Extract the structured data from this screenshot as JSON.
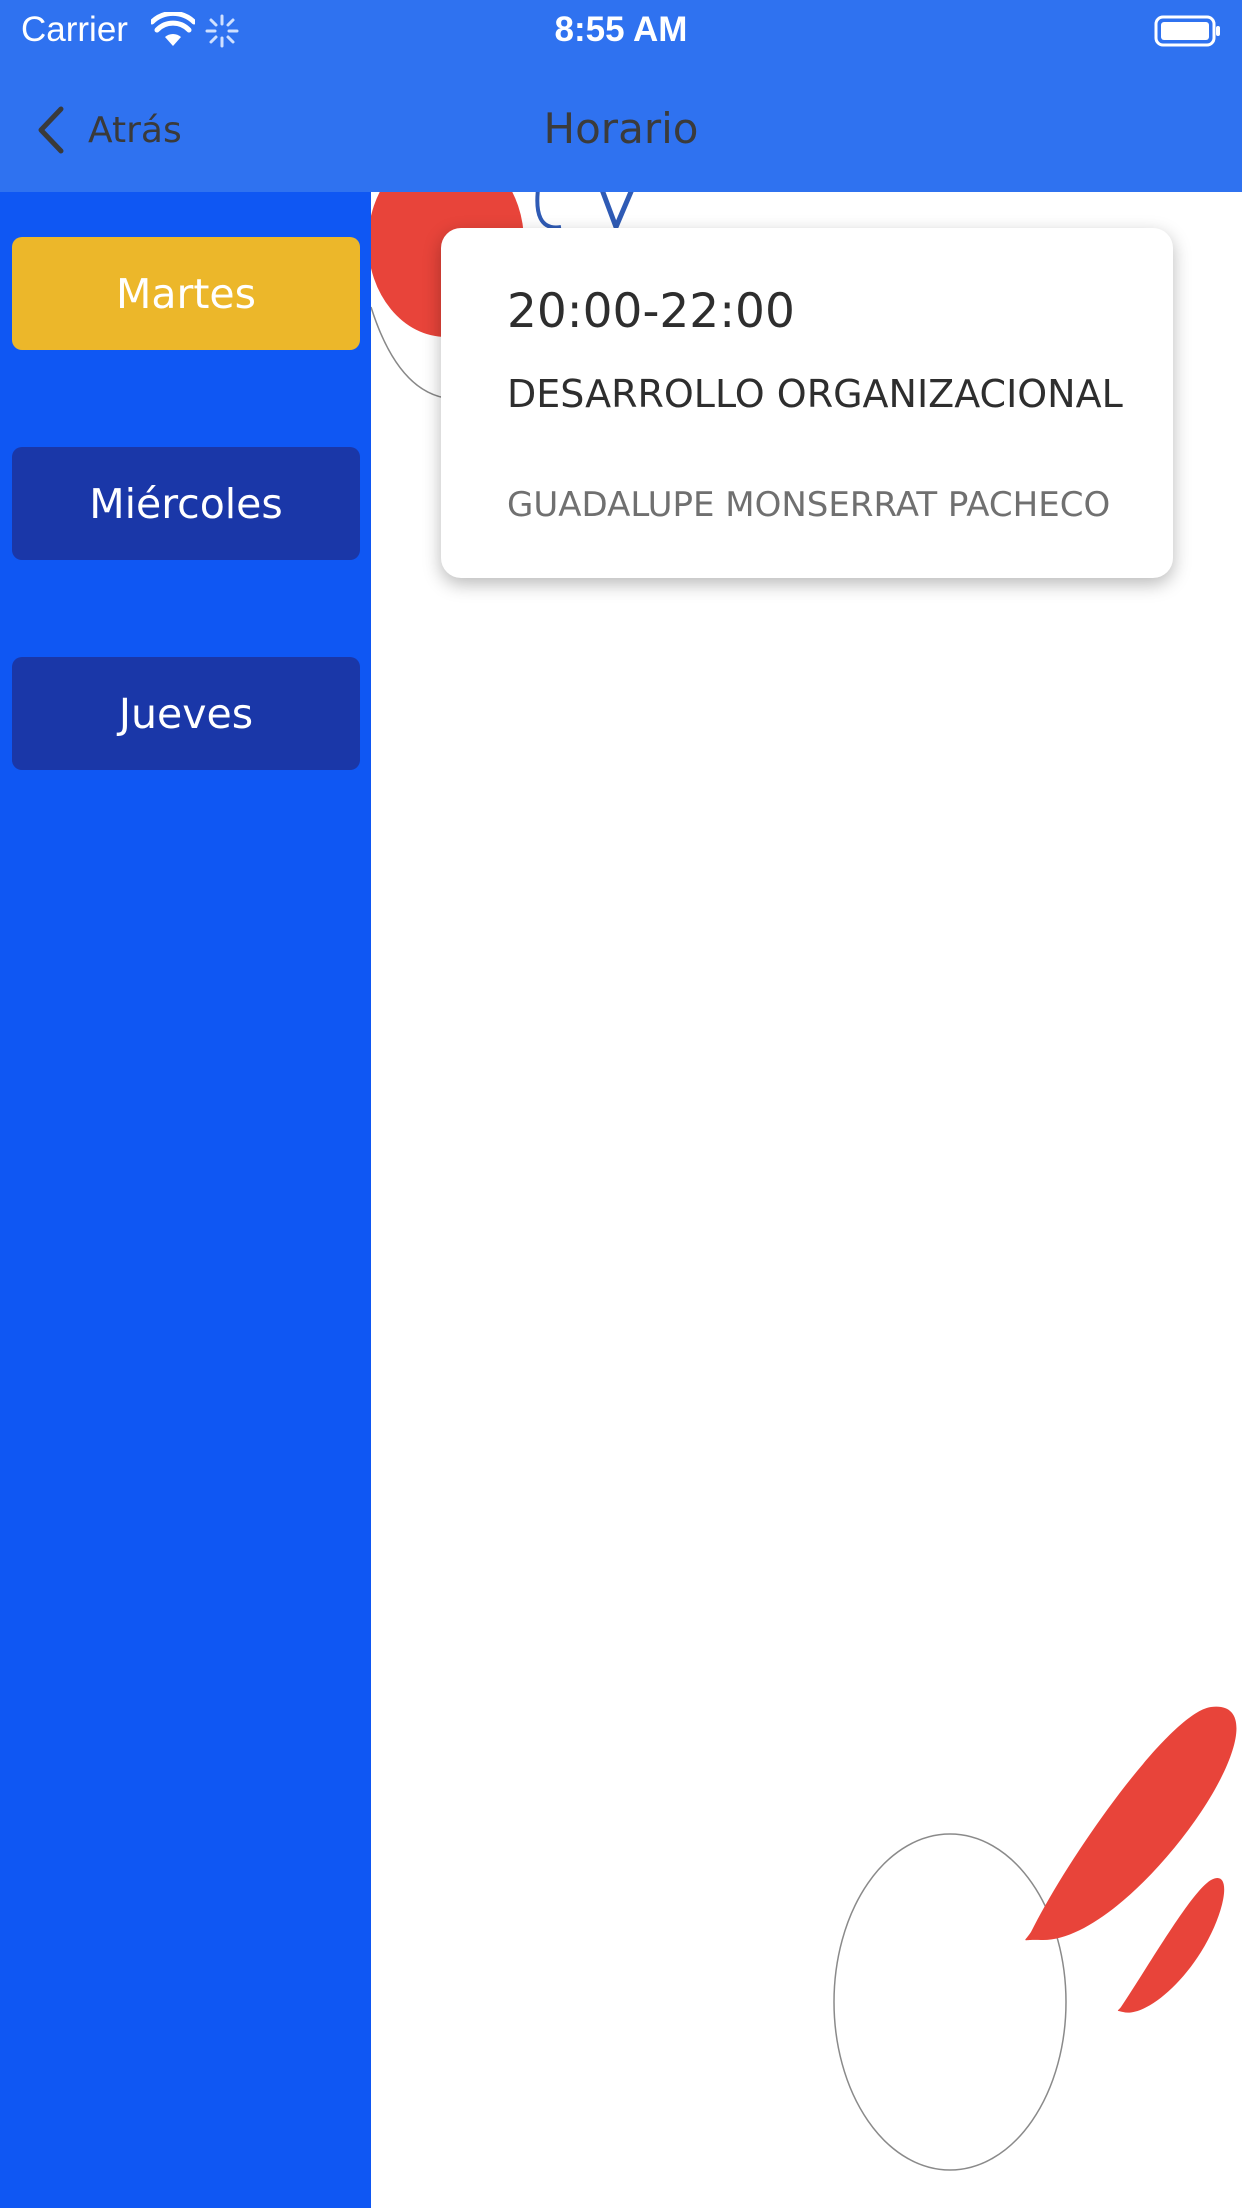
{
  "status_bar": {
    "carrier": "Carrier",
    "time": "8:55 AM",
    "icons": [
      "wifi-icon",
      "activity-spinner-icon",
      "battery-icon"
    ]
  },
  "nav": {
    "back_label": "Atrás",
    "title": "Horario"
  },
  "sidebar": {
    "days": [
      {
        "label": "Martes",
        "selected": true
      },
      {
        "label": "Miércoles",
        "selected": false
      },
      {
        "label": "Jueves",
        "selected": false
      }
    ]
  },
  "schedule": {
    "items": [
      {
        "time": "20:00-22:00",
        "subject": "DESARROLLO ORGANIZACIONAL",
        "teacher": "GUADALUPE MONSERRAT PACHECO"
      }
    ]
  },
  "colors": {
    "header": "#2f72f0",
    "sidebar": "#0f57f3",
    "day_selected": "#ecb72a",
    "day_unselected": "#1a37a8",
    "decoration_red": "#e8443a"
  }
}
